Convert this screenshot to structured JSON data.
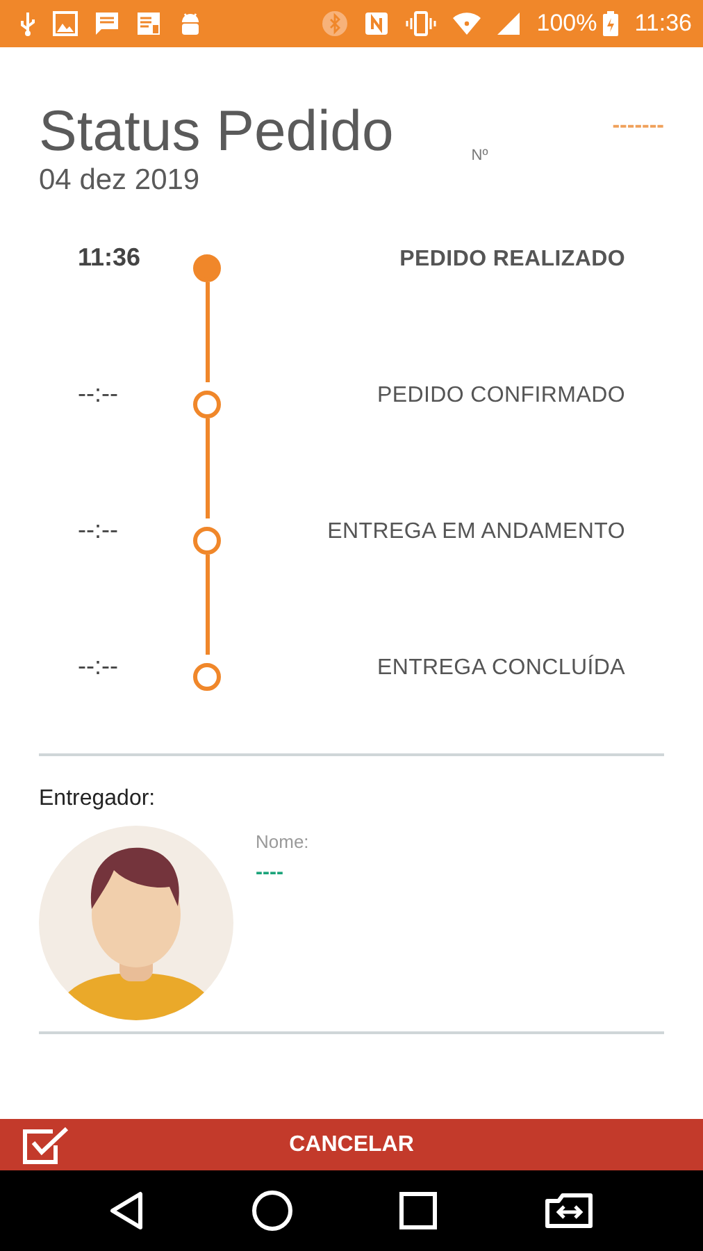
{
  "status_bar": {
    "battery": "100%",
    "time": "11:36"
  },
  "header": {
    "title": "Status Pedido",
    "number_label": "Nº",
    "number_value": "-------",
    "date": "04 dez 2019"
  },
  "steps": [
    {
      "time": "11:36",
      "label": "PEDIDO REALIZADO",
      "done": true
    },
    {
      "time": "--:--",
      "label": "PEDIDO CONFIRMADO",
      "done": false
    },
    {
      "time": "--:--",
      "label": "ENTREGA EM ANDAMENTO",
      "done": false
    },
    {
      "time": "--:--",
      "label": "ENTREGA CONCLUÍDA",
      "done": false
    }
  ],
  "courier": {
    "heading": "Entregador:",
    "name_label": "Nome:",
    "name_value": "----"
  },
  "action": {
    "label": "CANCELAR"
  }
}
